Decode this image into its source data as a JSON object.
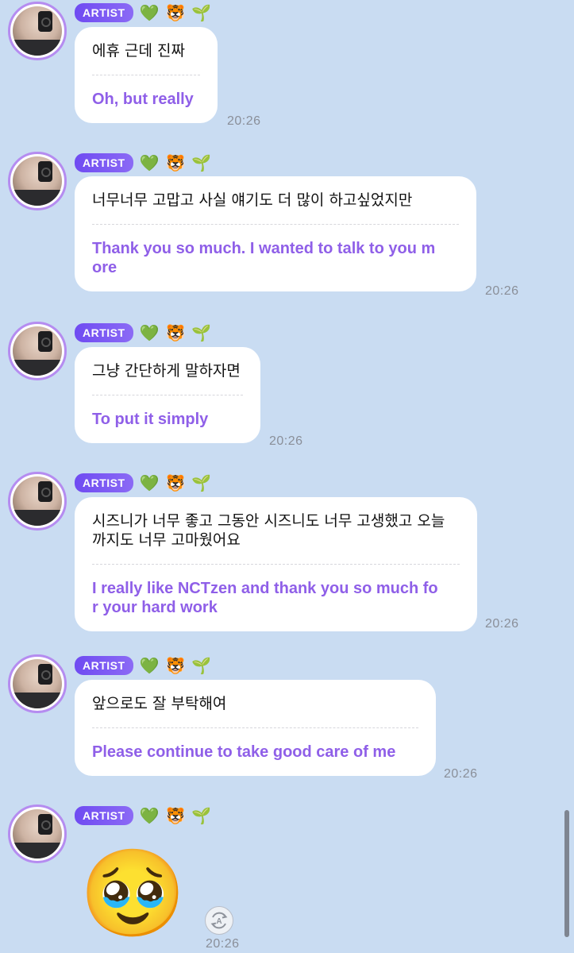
{
  "header": {
    "badge_label": "ARTIST",
    "emojis": [
      "💚",
      "🐯",
      "🌱"
    ]
  },
  "messages": [
    {
      "ko": "에휴 근데 진짜",
      "en": "Oh, but really",
      "time": "20:26"
    },
    {
      "ko": "너무너무 고맙고 사실 얘기도 더 많이 하고싶었지만",
      "en": "Thank you so much. I wanted to talk to you m\nore",
      "time": "20:26"
    },
    {
      "ko": "그냥 간단하게 말하자면",
      "en": "To put it simply",
      "time": "20:26"
    },
    {
      "ko": "시즈니가 너무 좋고 그동안 시즈니도 너무 고생했고 오늘\n까지도 너무 고마웠어요",
      "en": "I really like NCTzen and thank you so much fo\nr your hard work",
      "time": "20:26"
    },
    {
      "ko": "앞으로도 잘 부탁해여",
      "en": "Please continue to take good care of me",
      "time": "20:26"
    },
    {
      "emoji": "🥹",
      "time": "20:26"
    }
  ],
  "colors": {
    "background": "#c9dcf2",
    "translation_text": "#8f5fe8",
    "badge": "#7553f3",
    "avatar_ring": "#b58cf0"
  },
  "icons": {
    "translate": "translate-icon",
    "avatar": "avatar"
  }
}
